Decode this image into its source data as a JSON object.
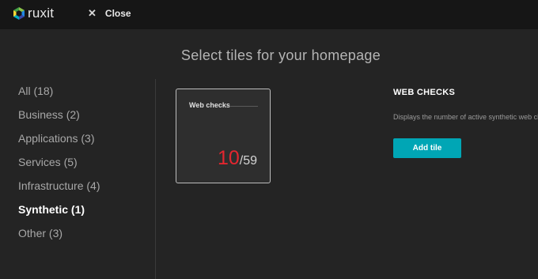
{
  "app": {
    "logo_text": "ruxit",
    "close_label": "Close",
    "close_icon": "close-icon"
  },
  "page": {
    "title": "Select tiles for your homepage"
  },
  "sidebar": {
    "items": [
      {
        "label": "All (18)",
        "active": false
      },
      {
        "label": "Business (2)",
        "active": false
      },
      {
        "label": "Applications (3)",
        "active": false
      },
      {
        "label": "Services (5)",
        "active": false
      },
      {
        "label": "Infrastructure (4)",
        "active": false
      },
      {
        "label": "Synthetic (1)",
        "active": true
      },
      {
        "label": "Other (3)",
        "active": false
      }
    ]
  },
  "tile": {
    "title": "Web checks",
    "value": "10",
    "total": "/59",
    "value_color": "#e4262f"
  },
  "detail": {
    "title": "WEB CHECKS",
    "description": "Displays the number of active synthetic web checks",
    "add_button": "Add tile",
    "button_color": "#00a6b5"
  }
}
